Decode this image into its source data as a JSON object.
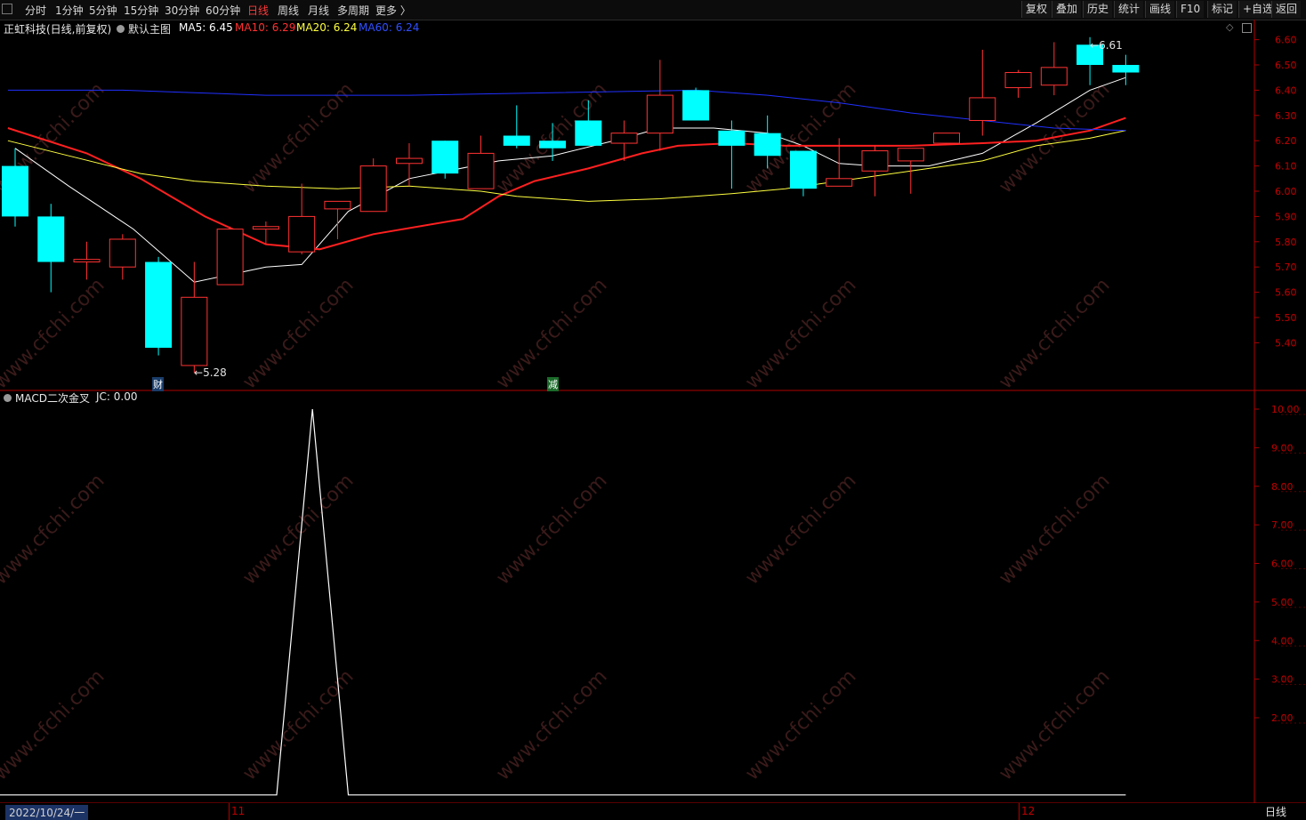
{
  "toolbar": {
    "periods": [
      "分时",
      "1分钟",
      "5分钟",
      "15分钟",
      "30分钟",
      "60分钟",
      "日线",
      "周线",
      "月线",
      "多周期",
      "更多 〉"
    ],
    "active_period": "日线",
    "right_buttons": [
      "复权",
      "叠加",
      "历史",
      "统计",
      "画线",
      "F10",
      "标记",
      "+自选",
      "返回"
    ]
  },
  "main_legend": {
    "stock": "正虹科技(日线,前复权)",
    "template": "默认主图",
    "ma5": "MA5: 6.45",
    "ma10": "MA10: 6.29",
    "ma20": "MA20: 6.24",
    "ma60": "MA60: 6.24"
  },
  "sub_legend": {
    "indicator": "MACD二次金叉",
    "value": "JC: 0.00"
  },
  "markers": {
    "low_label": "5.28",
    "high_label": "6.61",
    "tag_cai": "财",
    "tag_jian": "减"
  },
  "bottom": {
    "date_label": "2022/10/24/一",
    "month_11": "11",
    "month_12": "12",
    "period_label": "日线"
  },
  "colors": {
    "up": "#ff3232",
    "down": "#00ffff",
    "ma5": "#ffffff",
    "ma10": "#ff2020",
    "ma20": "#ffff40",
    "ma60": "#2030ff",
    "axis": "#b00000",
    "jc_line": "#ffffff"
  },
  "chart_data": [
    {
      "type": "candlestick",
      "title": "正虹科技(日线,前复权)",
      "x": [
        "c1",
        "c2",
        "c3",
        "c4",
        "c5",
        "c6",
        "c7",
        "c8",
        "c9",
        "c10",
        "c11",
        "c12",
        "c13",
        "c14",
        "c15",
        "c16",
        "c17",
        "c18",
        "c19",
        "c20",
        "c21",
        "c22",
        "c23",
        "c24",
        "c25",
        "c26",
        "c27",
        "c28",
        "c29",
        "c30",
        "c31",
        "c32"
      ],
      "ohlc": [
        [
          6.1,
          6.17,
          5.86,
          5.9
        ],
        [
          5.9,
          5.95,
          5.6,
          5.72
        ],
        [
          5.72,
          5.8,
          5.65,
          5.73
        ],
        [
          5.7,
          5.83,
          5.65,
          5.81
        ],
        [
          5.72,
          5.74,
          5.35,
          5.38
        ],
        [
          5.31,
          5.72,
          5.28,
          5.58
        ],
        [
          5.63,
          5.86,
          5.63,
          5.85
        ],
        [
          5.85,
          5.88,
          5.79,
          5.86
        ],
        [
          5.76,
          6.03,
          5.75,
          5.9
        ],
        [
          5.93,
          5.96,
          5.81,
          5.96
        ],
        [
          5.92,
          6.13,
          5.92,
          6.1
        ],
        [
          6.11,
          6.19,
          6.02,
          6.13
        ],
        [
          6.2,
          6.2,
          6.05,
          6.07
        ],
        [
          6.01,
          6.22,
          6.01,
          6.15
        ],
        [
          6.22,
          6.34,
          6.17,
          6.18
        ],
        [
          6.2,
          6.27,
          6.12,
          6.17
        ],
        [
          6.28,
          6.36,
          6.23,
          6.18
        ],
        [
          6.19,
          6.28,
          6.12,
          6.23
        ],
        [
          6.23,
          6.52,
          6.16,
          6.38
        ],
        [
          6.4,
          6.41,
          6.28,
          6.28
        ],
        [
          6.24,
          6.28,
          6.01,
          6.18
        ],
        [
          6.23,
          6.3,
          6.09,
          6.14
        ],
        [
          6.16,
          6.16,
          5.98,
          6.01
        ],
        [
          6.02,
          6.21,
          6.02,
          6.05
        ],
        [
          6.08,
          6.18,
          5.98,
          6.16
        ],
        [
          6.12,
          6.17,
          5.99,
          6.17
        ],
        [
          6.19,
          6.23,
          6.19,
          6.23
        ],
        [
          6.28,
          6.56,
          6.22,
          6.37
        ],
        [
          6.41,
          6.48,
          6.37,
          6.47
        ],
        [
          6.42,
          6.59,
          6.38,
          6.49
        ],
        [
          6.58,
          6.61,
          6.42,
          6.5
        ],
        [
          6.5,
          6.54,
          6.42,
          6.47
        ]
      ],
      "ma_series": [
        {
          "name": "MA5",
          "points": [
            [
              1,
              6.17
            ],
            [
              2.5,
              6.02
            ],
            [
              4.3,
              5.85
            ],
            [
              6,
              5.64
            ],
            [
              8,
              5.7
            ],
            [
              9,
              5.71
            ],
            [
              10.3,
              5.92
            ],
            [
              12,
              6.05
            ],
            [
              14.5,
              6.12
            ],
            [
              16,
              6.14
            ],
            [
              18,
              6.21
            ],
            [
              19,
              6.25
            ],
            [
              20.5,
              6.25
            ],
            [
              22,
              6.23
            ],
            [
              23,
              6.18
            ],
            [
              24,
              6.11
            ],
            [
              25,
              6.1
            ],
            [
              26.5,
              6.1
            ],
            [
              28,
              6.15
            ],
            [
              29.5,
              6.27
            ],
            [
              31,
              6.4
            ],
            [
              32,
              6.45
            ]
          ]
        },
        {
          "name": "MA10",
          "points": [
            [
              0.8,
              6.25
            ],
            [
              3,
              6.15
            ],
            [
              4.5,
              6.05
            ],
            [
              6.3,
              5.9
            ],
            [
              8,
              5.79
            ],
            [
              9.5,
              5.77
            ],
            [
              11,
              5.83
            ],
            [
              13.5,
              5.89
            ],
            [
              14.5,
              5.98
            ],
            [
              15.5,
              6.04
            ],
            [
              17,
              6.09
            ],
            [
              18.5,
              6.15
            ],
            [
              19.5,
              6.18
            ],
            [
              21,
              6.19
            ],
            [
              22.5,
              6.18
            ],
            [
              24,
              6.18
            ],
            [
              26,
              6.18
            ],
            [
              28,
              6.19
            ],
            [
              29.5,
              6.2
            ],
            [
              31,
              6.24
            ],
            [
              32,
              6.29
            ]
          ]
        },
        {
          "name": "MA20",
          "points": [
            [
              0.8,
              6.2
            ],
            [
              2.5,
              6.14
            ],
            [
              4.5,
              6.07
            ],
            [
              6,
              6.04
            ],
            [
              8,
              6.02
            ],
            [
              10,
              6.01
            ],
            [
              12,
              6.02
            ],
            [
              14,
              6.0
            ],
            [
              15,
              5.98
            ],
            [
              17,
              5.96
            ],
            [
              19,
              5.97
            ],
            [
              21,
              5.99
            ],
            [
              22.5,
              6.01
            ],
            [
              24,
              6.04
            ],
            [
              26,
              6.08
            ],
            [
              28,
              6.12
            ],
            [
              29.5,
              6.18
            ],
            [
              31,
              6.21
            ],
            [
              32,
              6.24
            ]
          ]
        },
        {
          "name": "MA60",
          "points": [
            [
              0.8,
              6.4
            ],
            [
              4,
              6.4
            ],
            [
              6,
              6.39
            ],
            [
              8,
              6.38
            ],
            [
              12,
              6.38
            ],
            [
              16,
              6.39
            ],
            [
              20,
              6.4
            ],
            [
              22,
              6.38
            ],
            [
              24,
              6.35
            ],
            [
              26,
              6.31
            ],
            [
              28,
              6.28
            ],
            [
              30,
              6.25
            ],
            [
              32,
              6.24
            ]
          ]
        }
      ],
      "ylim": [
        5.28,
        6.65
      ],
      "yticks": [
        5.4,
        5.5,
        5.6,
        5.7,
        5.8,
        5.9,
        6.0,
        6.1,
        6.2,
        6.3,
        6.4,
        6.5,
        6.6
      ]
    },
    {
      "type": "line",
      "title": "MACD二次金叉",
      "series": [
        {
          "name": "JC",
          "points": [
            [
              0.5,
              0
            ],
            [
              8.3,
              0
            ],
            [
              9.3,
              10
            ],
            [
              10.3,
              0
            ],
            [
              32,
              0
            ]
          ]
        }
      ],
      "ylim": [
        0.8,
        10.5
      ],
      "yticks": [
        2.0,
        3.0,
        4.0,
        5.0,
        6.0,
        7.0,
        8.0,
        9.0,
        10.0
      ]
    }
  ]
}
